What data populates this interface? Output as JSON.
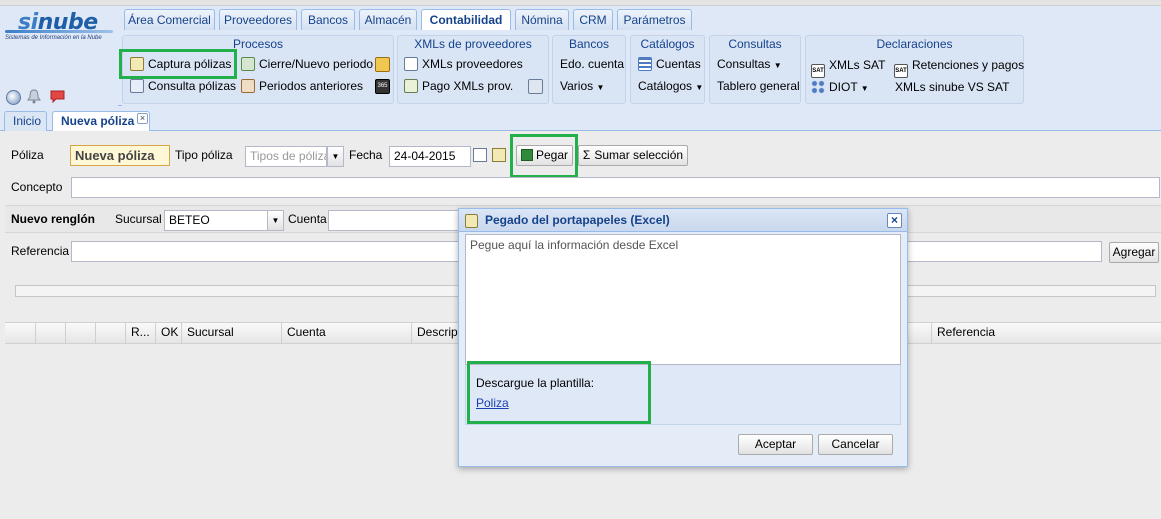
{
  "logo": {
    "brand_si": "si",
    "brand_nube": "nube",
    "subtitle": "Sistemas de Información en la Nube"
  },
  "main_tabs": [
    {
      "label": "Área Comercial"
    },
    {
      "label": "Proveedores"
    },
    {
      "label": "Bancos"
    },
    {
      "label": "Almacén"
    },
    {
      "label": "Contabilidad"
    },
    {
      "label": "Nómina"
    },
    {
      "label": "CRM"
    },
    {
      "label": "Parámetros"
    }
  ],
  "ribbon": {
    "procesos": {
      "title": "Procesos",
      "captura": "Captura pólizas",
      "consulta": "Consulta pólizas",
      "cierre": "Cierre/Nuevo periodo",
      "periodos": "Periodos anteriores"
    },
    "xmls": {
      "title": "XMLs de proveedores",
      "proveedores": "XMLs proveedores",
      "pago": "Pago XMLs prov."
    },
    "bancos": {
      "title": "Bancos",
      "edo": "Edo. cuenta",
      "varios": "Varios"
    },
    "catalogos": {
      "title": "Catálogos",
      "cuentas": "Cuentas",
      "catalogos": "Catálogos"
    },
    "consultas": {
      "title": "Consultas",
      "consultas": "Consultas",
      "tablero": "Tablero general"
    },
    "declaraciones": {
      "title": "Declaraciones",
      "xmls_sat": "XMLs SAT",
      "retenciones": "Retenciones y pagos",
      "diot": "DIOT",
      "xmls_sinube": "XMLs sinube VS SAT"
    }
  },
  "page_tabs": {
    "inicio": "Inicio",
    "nueva": "Nueva póliza"
  },
  "form": {
    "poliza_label": "Póliza",
    "poliza_value": "Nueva póliza",
    "tipo_label": "Tipo póliza",
    "tipo_placeholder": "Tipos de póliza",
    "fecha_label": "Fecha",
    "fecha_value": "24-04-2015",
    "pegar_label": "Pegar",
    "sumar_label": "Sumar selección",
    "concepto_label": "Concepto",
    "nuevo_renglon_label": "Nuevo renglón",
    "sucursal_label": "Sucursal",
    "sucursal_value": "BETEO",
    "cuenta_label": "Cuenta",
    "referencia_label": "Referencia",
    "agregar_label": "Agregar"
  },
  "grid": {
    "columns": [
      "R...",
      "OK",
      "Sucursal",
      "Cuenta",
      "Descripc",
      "Referencia"
    ]
  },
  "dialog": {
    "title": "Pegado del portapapeles (Excel)",
    "placeholder": "Pegue aquí la información desde Excel",
    "descargue": "Descargue la plantilla:",
    "link": "Poliza",
    "aceptar": "Aceptar",
    "cancelar": "Cancelar"
  },
  "colors": {
    "accent": "#15428b",
    "highlight": "#22b04a",
    "header_bg": "#dfe8f6"
  }
}
